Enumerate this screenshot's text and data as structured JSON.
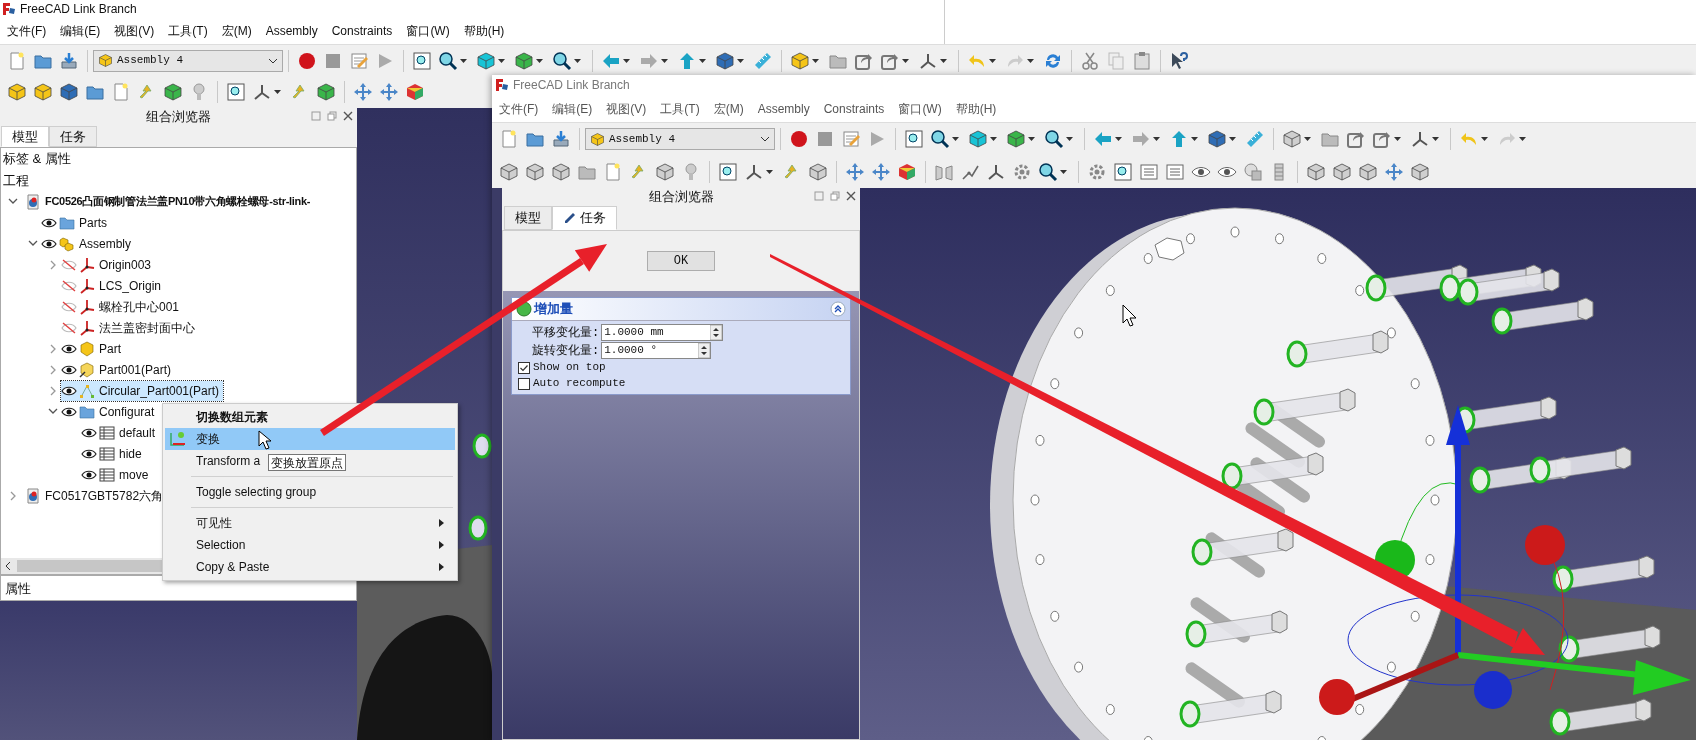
{
  "back_window": {
    "title": "FreeCAD Link Branch",
    "menu": [
      "文件(F)",
      "编辑(E)",
      "视图(V)",
      "工具(T)",
      "宏(M)",
      "Assembly",
      "Constraints",
      "窗口(W)",
      "帮助(H)"
    ],
    "workbench": "Assembly 4",
    "combo_view": {
      "title": "组合浏览器",
      "tabs": [
        {
          "label": "模型",
          "selected": true
        },
        {
          "label": "任务",
          "selected": false
        }
      ],
      "tree_header": "标签 & 属性",
      "tree_root": "工程",
      "tree": [
        {
          "label": "FC0526凸面钢制管法兰盖PN10带六角螺栓螺母-str-link-",
          "kind": "document",
          "expanded": true,
          "active": true,
          "selected": false,
          "children": [
            {
              "label": "Parts",
              "kind": "folder",
              "visible": true,
              "selected": false
            },
            {
              "label": "Assembly",
              "kind": "assembly",
              "expanded": true,
              "visible": true,
              "selected": false,
              "children": [
                {
                  "label": "Origin003",
                  "kind": "axes",
                  "expanded": false,
                  "visible": false,
                  "selected": false
                },
                {
                  "label": "LCS_Origin",
                  "kind": "axes",
                  "visible": false,
                  "selected": false
                },
                {
                  "label": "螺栓孔中心001",
                  "kind": "axes",
                  "visible": false,
                  "selected": false
                },
                {
                  "label": "法兰盖密封面中心",
                  "kind": "axes",
                  "visible": false,
                  "selected": false
                },
                {
                  "label": "Part",
                  "kind": "part",
                  "expanded": false,
                  "visible": true,
                  "selected": false
                },
                {
                  "label": "Part001(Part)",
                  "kind": "part_link",
                  "expanded": false,
                  "visible": true,
                  "selected": false
                },
                {
                  "label": "Circular_Part001(Part)",
                  "kind": "array",
                  "expanded": false,
                  "visible": true,
                  "selected": true
                },
                {
                  "label": "Configurat",
                  "kind": "folder",
                  "expanded": true,
                  "visible": true,
                  "selected": false,
                  "children": [
                    {
                      "label": "default",
                      "kind": "table",
                      "visible": true,
                      "selected": false
                    },
                    {
                      "label": "hide",
                      "kind": "table",
                      "visible": true,
                      "selected": false
                    },
                    {
                      "label": "move",
                      "kind": "table",
                      "visible": true,
                      "selected": false
                    }
                  ]
                }
              ]
            }
          ]
        },
        {
          "label": "FC0517GBT5782六角",
          "kind": "document",
          "expanded": false,
          "active": false,
          "selected": false
        }
      ],
      "property_header": "属性"
    }
  },
  "context_menu": {
    "items": [
      {
        "kind": "header",
        "label": "切换数组元素",
        "highlighted": false
      },
      {
        "kind": "icon_action",
        "label": "变换",
        "highlighted": true
      },
      {
        "kind": "action",
        "label": "Transform a",
        "highlighted": false
      },
      {
        "kind": "separator"
      },
      {
        "kind": "action",
        "label": "Toggle selecting group",
        "highlighted": false
      },
      {
        "kind": "separator"
      },
      {
        "kind": "submenu",
        "label": "可见性",
        "highlighted": false
      },
      {
        "kind": "submenu",
        "label": "Selection",
        "highlighted": false
      },
      {
        "kind": "submenu",
        "label": "Copy & Paste",
        "highlighted": false
      }
    ]
  },
  "tooltip": "变换放置原点",
  "front_window": {
    "title": "FreeCAD Link Branch",
    "menu": [
      "文件(F)",
      "编辑(E)",
      "视图(V)",
      "工具(T)",
      "宏(M)",
      "Assembly",
      "Constraints",
      "窗口(W)",
      "帮助(H)"
    ],
    "workbench": "Assembly 4",
    "combo_view": {
      "title": "组合浏览器",
      "tabs": [
        {
          "label": "模型",
          "selected": false
        },
        {
          "label": "任务",
          "selected": true
        }
      ]
    },
    "task": {
      "button": "OK",
      "panel": {
        "title": "增加量",
        "expanded": true,
        "fields": [
          {
            "label": "平移变化量:",
            "value": "1.0000 mm"
          },
          {
            "label": "旋转变化量:",
            "value": "1.0000 °"
          }
        ],
        "options": [
          {
            "label": "Show on top",
            "checked": true
          },
          {
            "label": "Auto recompute",
            "checked": false
          }
        ]
      }
    }
  }
}
